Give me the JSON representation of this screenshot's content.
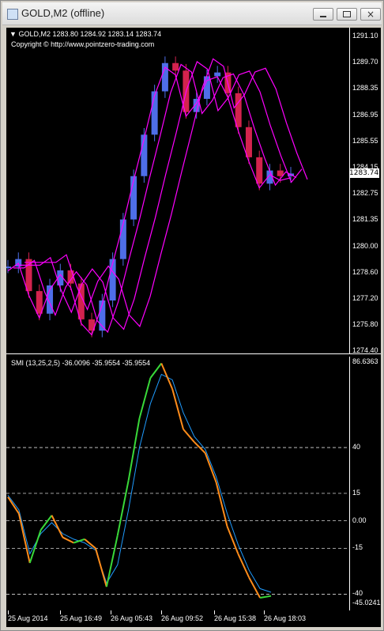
{
  "window": {
    "title": "GOLD,M2 (offline)",
    "buttons": [
      "minimize-icon",
      "restore-icon",
      "close-icon"
    ]
  },
  "main_chart": {
    "symbol_line": "GOLD,M2  1283.80 1284.92 1283.14 1283.74",
    "copyright": "Copyright © http://www.pointzero-trading.com",
    "last_price": "1283.74",
    "price_labels": [
      "1291.10",
      "1289.70",
      "1288.35",
      "1286.95",
      "1285.55",
      "1284.15",
      "1282.75",
      "1281.35",
      "1280.00",
      "1278.60",
      "1277.20",
      "1275.80",
      "1274.40"
    ]
  },
  "smi_chart": {
    "label": "SMI (13,25,2,5) -36.0096 -35.9554 -35.9554",
    "levels": [
      "86.6363",
      "40",
      "15",
      "0.00",
      "-15",
      "-40",
      "-45.0241"
    ]
  },
  "time_axis": {
    "labels": [
      "25 Aug 2014",
      "25 Aug 16:49",
      "26 Aug 05:43",
      "26 Aug 09:52",
      "26 Aug 15:38",
      "26 Aug 18:03"
    ]
  },
  "chart_data": [
    {
      "type": "line",
      "title": "GOLD,M2",
      "approx_close_path": [
        1278.8,
        1279.2,
        1277.5,
        1276.3,
        1277.8,
        1278.6,
        1277.9,
        1276.0,
        1275.4,
        1277.0,
        1279.2,
        1281.3,
        1283.6,
        1285.8,
        1288.1,
        1289.6,
        1289.2,
        1287.0,
        1287.7,
        1288.9,
        1289.1,
        1288.0,
        1286.2,
        1284.6,
        1283.2,
        1283.9,
        1283.6,
        1283.74
      ],
      "ylim": [
        1274.4,
        1291.1
      ],
      "bull_color": "#4e6ee8",
      "bear_color": "#d3234e",
      "envelope_color": "#ff00ff"
    },
    {
      "type": "line",
      "title": "SMI (13,25,2,5)",
      "series": [
        {
          "name": "SMI",
          "values": [
            13,
            4,
            -23,
            -5,
            3,
            -9,
            -12,
            -10,
            -15,
            -36,
            -8,
            22,
            56,
            78,
            86,
            72,
            50,
            43,
            37,
            21,
            -3,
            -18,
            -31,
            -42,
            -41
          ]
        },
        {
          "name": "Signal",
          "values": [
            14,
            6,
            -18,
            -7,
            -1,
            -7,
            -10,
            -12,
            -16,
            -34,
            -24,
            6,
            40,
            64,
            80,
            77,
            59,
            46,
            39,
            24,
            4,
            -13,
            -27,
            -37,
            -39
          ]
        }
      ],
      "ylim": [
        -45.0241,
        86.6363
      ],
      "levels": [
        40,
        15,
        0,
        -15,
        -40
      ],
      "colors": {
        "up": "#39d939",
        "down": "#ff8c1a",
        "signal": "#1f9cff"
      }
    }
  ]
}
